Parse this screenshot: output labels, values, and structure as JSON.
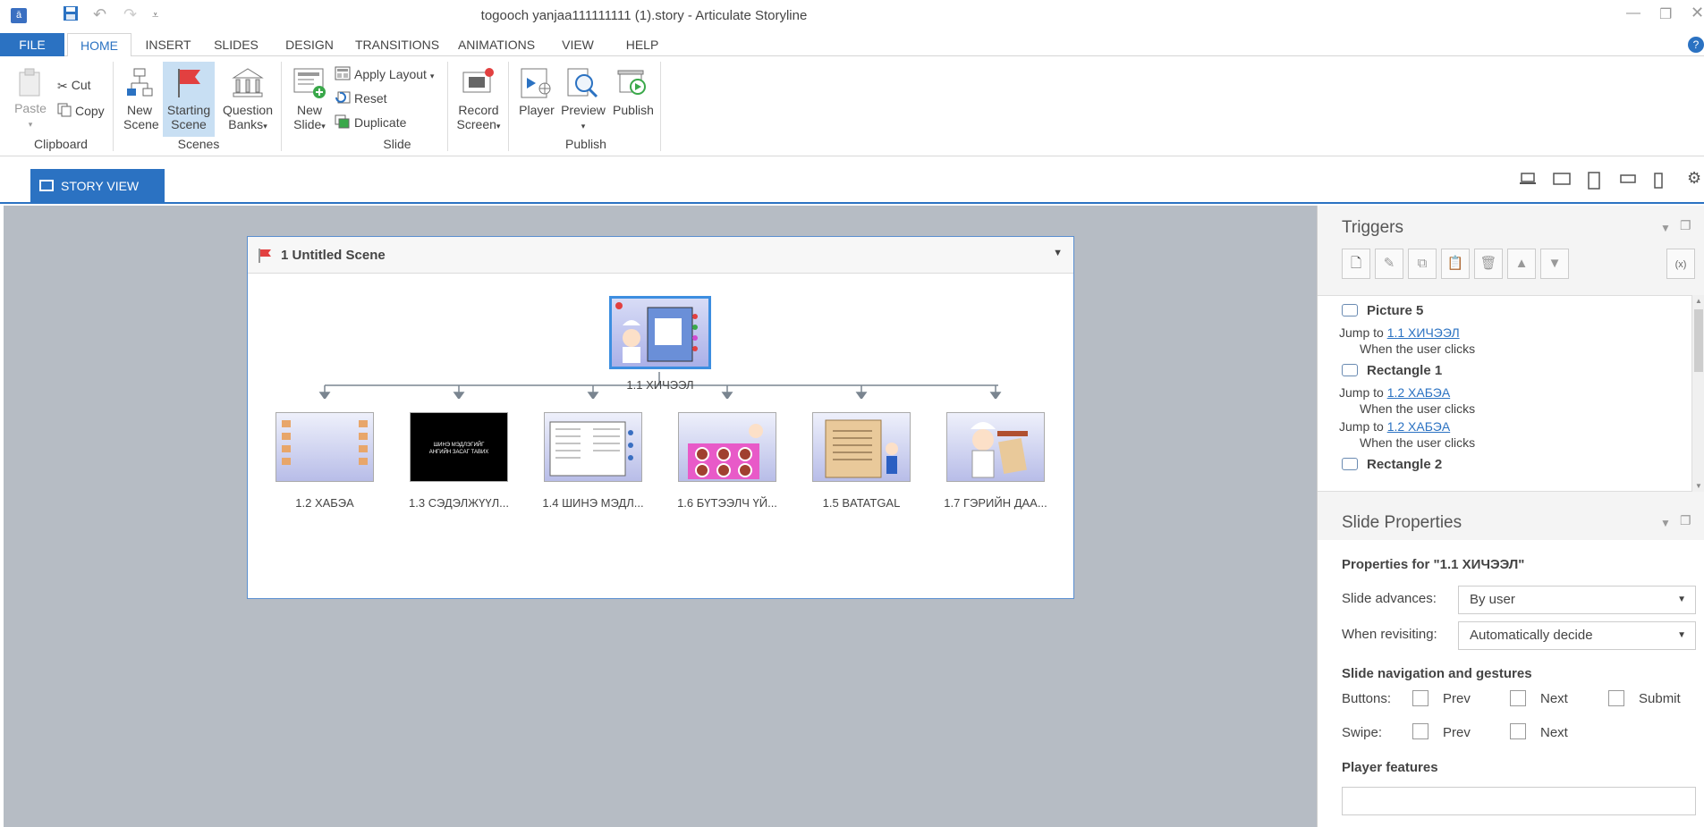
{
  "titlebar": {
    "title": "togooch yanjaa111111111 (1).story -  Articulate Storyline",
    "app_icon": "storyline-logo-icon"
  },
  "tabs": [
    "FILE",
    "HOME",
    "INSERT",
    "SLIDES",
    "DESIGN",
    "TRANSITIONS",
    "ANIMATIONS",
    "VIEW",
    "HELP"
  ],
  "ribbon": {
    "paste": "Paste",
    "cut": "Cut",
    "copy": "Copy",
    "clipboard": "Clipboard",
    "new_scene_1": "New",
    "new_scene_2": "Scene",
    "starting_scene_1": "Starting",
    "starting_scene_2": "Scene",
    "question_banks_1": "Question",
    "question_banks_2": "Banks",
    "scenes": "Scenes",
    "new_slide_1": "New",
    "new_slide_2": "Slide",
    "apply_layout": "Apply Layout",
    "reset": "Reset",
    "duplicate": "Duplicate",
    "slide": "Slide",
    "record_screen_1": "Record",
    "record_screen_2": "Screen",
    "player": "Player",
    "preview": "Preview",
    "publish_btn": "Publish",
    "publish_group": "Publish"
  },
  "viewbar": {
    "story_view": "STORY VIEW"
  },
  "scene": {
    "title": "1 Untitled Scene",
    "root_slide": "1.1 ХИЧЭЭЛ",
    "slides": [
      "1.2 ХАБЭА",
      "1.3 СЭДЭЛЖҮҮЛ...",
      "1.4 ШИНЭ МЭДЛ...",
      "1.6 БҮТЭЭЛЧ ҮЙ...",
      "1.5 BATATGAL",
      "1.7 ГЭРИЙН ДАА..."
    ],
    "thumb_text": "ШИНЭ МЭДЛЭГИЙГ АНГИЙН ЗАСАГ ТАВИХ"
  },
  "triggers": {
    "title": "Triggers",
    "items": [
      {
        "object": "Picture 5",
        "jump_prefix": "Jump to",
        "target": "1.1 ХИЧЭЭЛ",
        "when": "When the user clicks"
      },
      {
        "object": "Rectangle 1",
        "jump_prefix": "Jump to",
        "target": "1.2 ХАБЭА",
        "when": "When the user clicks"
      },
      {
        "object": "",
        "jump_prefix": "Jump to",
        "target": "1.2 ХАБЭА",
        "when": "When the user clicks"
      },
      {
        "object": "Rectangle 2",
        "jump_prefix": "",
        "target": "",
        "when": ""
      }
    ]
  },
  "slide_properties": {
    "title": "Slide Properties",
    "properties_for": "Properties for \"1.1 ХИЧЭЭЛ\"",
    "slide_advances_label": "Slide advances:",
    "slide_advances_value": "By user",
    "when_revisiting_label": "When revisiting:",
    "when_revisiting_value": "Automatically decide",
    "nav_heading": "Slide navigation and gestures",
    "buttons_label": "Buttons:",
    "swipe_label": "Swipe:",
    "prev": "Prev",
    "next": "Next",
    "submit": "Submit",
    "player_features": "Player features"
  },
  "colors": {
    "accent": "#2b72c2",
    "canvas": "#b6bcc4",
    "selected": "#c8dff3"
  }
}
